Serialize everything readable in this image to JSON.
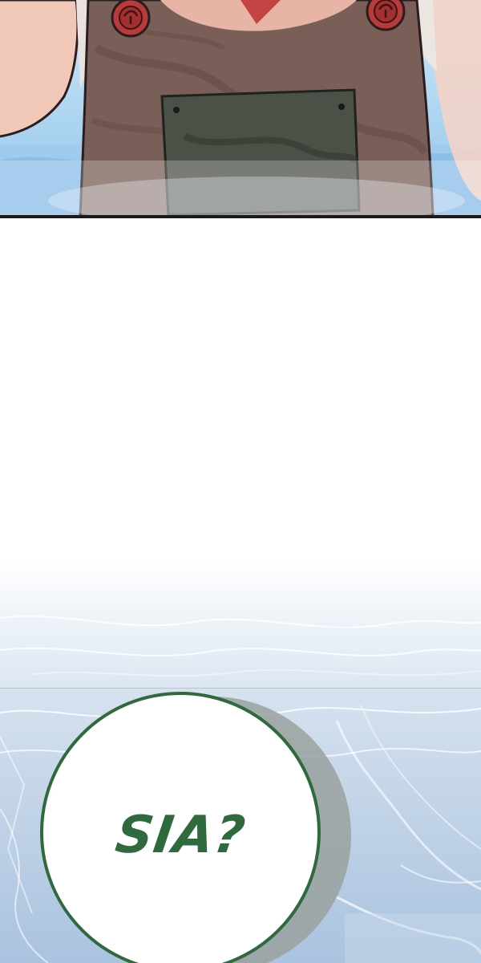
{
  "dialogue": {
    "speech_bubble_text": "SIA?"
  },
  "colors": {
    "bubble_outline": "#2f6a3d",
    "bubble_text": "#2f6a3d",
    "panel_border": "#1a1a1a",
    "overalls": "#7a5f58",
    "button": "#b83a3a",
    "water": "#aac3df"
  }
}
